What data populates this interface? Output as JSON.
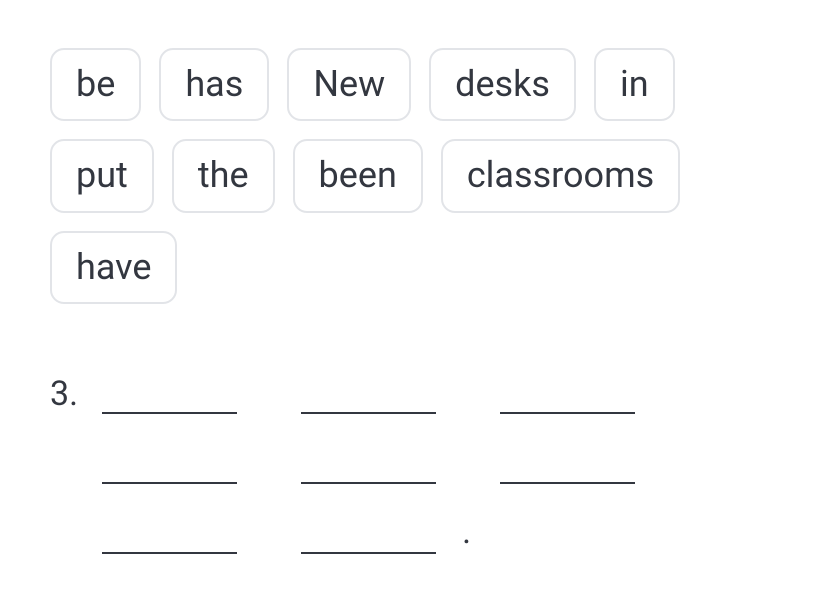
{
  "wordBank": {
    "words": [
      "be",
      "has",
      "New",
      "desks",
      "in",
      "put",
      "the",
      "been",
      "classrooms",
      "have"
    ]
  },
  "question": {
    "number": "3.",
    "period": "."
  }
}
